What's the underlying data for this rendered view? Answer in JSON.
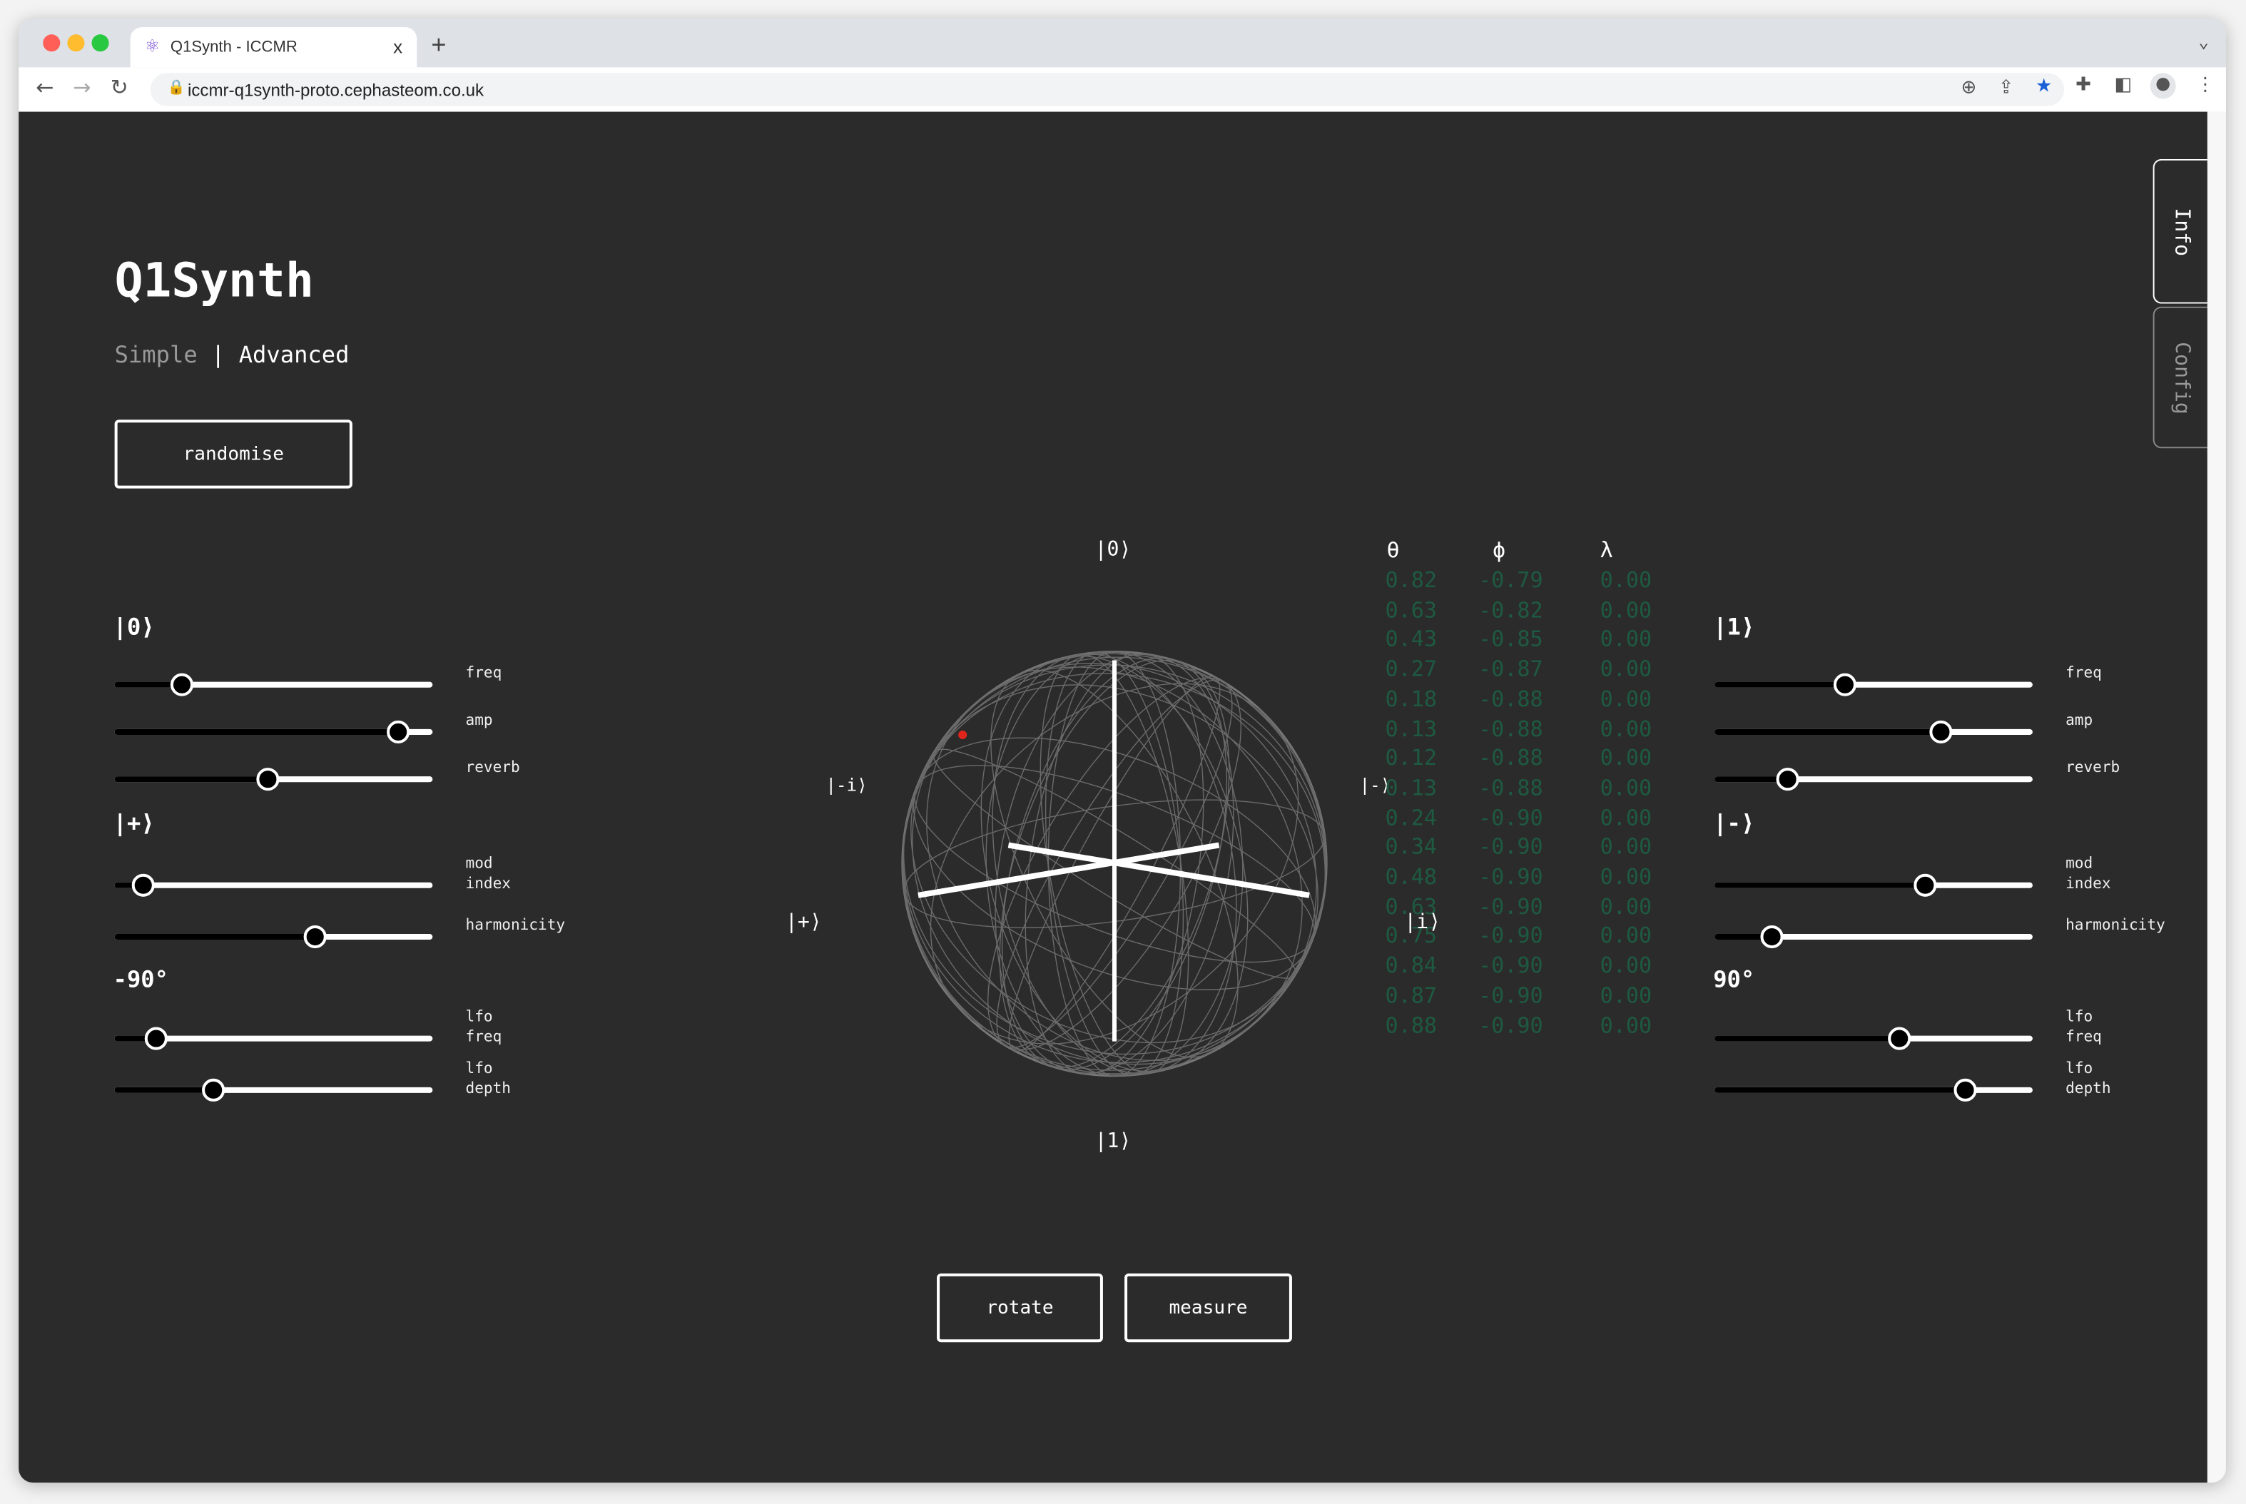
{
  "browser": {
    "tab_title": "Q1Synth - ICCMR",
    "tab_close": "x",
    "new_tab": "+",
    "url": "iccmr-q1synth-proto.cephasteom.co.uk"
  },
  "app": {
    "title": "Q1Synth",
    "mode_simple": "Simple",
    "mode_sep": "|",
    "mode_advanced": "Advanced",
    "randomise": "randomise",
    "rotate": "rotate",
    "measure": "measure",
    "side_tabs": [
      "Info",
      "Config"
    ]
  },
  "left": {
    "groups": [
      {
        "heading": "|0⟩",
        "sliders": [
          {
            "label": "freq",
            "value": 0.21
          },
          {
            "label": "amp",
            "value": 0.89
          },
          {
            "label": "reverb",
            "value": 0.48
          }
        ]
      },
      {
        "heading": "|+⟩",
        "sliders": [
          {
            "label": "mod index",
            "value": 0.09
          },
          {
            "label": "harmonicity",
            "value": 0.63
          }
        ]
      },
      {
        "heading": "-90°",
        "sliders": [
          {
            "label": "lfo freq",
            "value": 0.13
          },
          {
            "label": "lfo depth",
            "value": 0.31
          }
        ]
      }
    ]
  },
  "right": {
    "groups": [
      {
        "heading": "|1⟩",
        "sliders": [
          {
            "label": "freq",
            "value": 0.41
          },
          {
            "label": "amp",
            "value": 0.71
          },
          {
            "label": "reverb",
            "value": 0.23
          }
        ]
      },
      {
        "heading": "|-⟩",
        "sliders": [
          {
            "label": "mod index",
            "value": 0.66
          },
          {
            "label": "harmonicity",
            "value": 0.18
          }
        ]
      },
      {
        "heading": "90°",
        "sliders": [
          {
            "label": "lfo freq",
            "value": 0.58
          },
          {
            "label": "lfo depth",
            "value": 0.79
          }
        ]
      }
    ]
  },
  "sphere": {
    "labels": {
      "zero": "|0⟩",
      "one": "|1⟩",
      "minus_i": "|-i⟩",
      "minus": "|-⟩",
      "plus": "|+⟩",
      "i": "|i⟩"
    },
    "state_color": "#e0261b"
  },
  "table": {
    "headers": [
      "θ",
      "ϕ",
      "λ"
    ],
    "rows": [
      [
        "0.82",
        "-0.79",
        "0.00"
      ],
      [
        "0.63",
        "-0.82",
        "0.00"
      ],
      [
        "0.43",
        "-0.85",
        "0.00"
      ],
      [
        "0.27",
        "-0.87",
        "0.00"
      ],
      [
        "0.18",
        "-0.88",
        "0.00"
      ],
      [
        "0.13",
        "-0.88",
        "0.00"
      ],
      [
        "0.12",
        "-0.88",
        "0.00"
      ],
      [
        "0.13",
        "-0.88",
        "0.00"
      ],
      [
        "0.24",
        "-0.90",
        "0.00"
      ],
      [
        "0.34",
        "-0.90",
        "0.00"
      ],
      [
        "0.48",
        "-0.90",
        "0.00"
      ],
      [
        "0.63",
        "-0.90",
        "0.00"
      ],
      [
        "0.75",
        "-0.90",
        "0.00"
      ],
      [
        "0.84",
        "-0.90",
        "0.00"
      ],
      [
        "0.87",
        "-0.90",
        "0.00"
      ],
      [
        "0.88",
        "-0.90",
        "0.00"
      ]
    ]
  }
}
